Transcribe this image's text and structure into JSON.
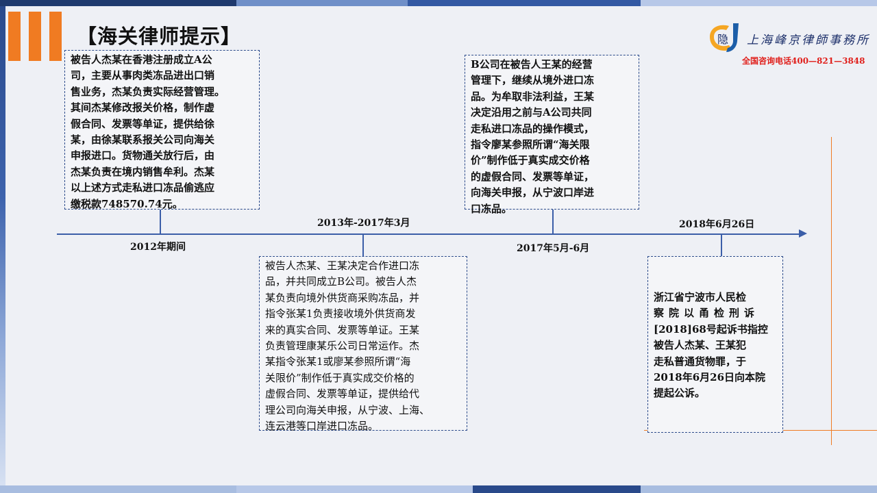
{
  "header": {
    "title": "【海关律师提示】",
    "firm_name": "上海峰京律師事務所",
    "phone": "全国咨询电话400—821—3848",
    "logo_char": "隐"
  },
  "colors": {
    "accent_orange": "#f07b22",
    "timeline_blue": "#3b5ea8",
    "phone_red": "#e0201c"
  },
  "timeline": {
    "events": [
      {
        "date": "2012年期间",
        "lines": [
          "被告人杰某在香港注册成立A公",
          "司，主要从事肉类冻品进出口销",
          "售业务，杰某负责实际经营管理。",
          "其间杰某修改报关价格，制作虚",
          "假合同、发票等单证，提供给徐",
          "某，由徐某联系报关公司向海关",
          "申报进口。货物通关放行后，由",
          "杰某负责在境内销售牟利。杰某",
          "以上述方式走私进口冻品偷逃应",
          "缴税款748570.74元。"
        ]
      },
      {
        "date": "2013年-2017年3月",
        "lines": [
          "被告人杰某、王某决定合作进口冻",
          "品，并共同成立B公司。被告人杰",
          "某负责向境外供货商采购冻品，并",
          "指令张某1负责接收境外供货商发",
          "来的真实合同、发票等单证。王某",
          "负责管理康某乐公司日常运作。杰",
          "某指令张某1或廖某参照所谓“海",
          "关限价”制作低于真实成交价格的",
          "虚假合同、发票等单证，提供给代",
          "理公司向海关申报，从宁波、上海、",
          "连云港等口岸进口冻品。"
        ]
      },
      {
        "date": "2017年5月-6月",
        "lines": [
          "B公司在被告人王某的经营",
          "管理下，继续从境外进口冻",
          "品。为牟取非法利益，王某",
          "决定沿用之前与A公司共同",
          "走私进口冻品的操作模式，",
          "指令廖某参照所谓“海关限",
          "价”制作低于真实成交价格",
          "的虚假合同、发票等单证，",
          "向海关申报，从宁波口岸进",
          "口冻品。"
        ]
      },
      {
        "date": "2018年6月26日",
        "lines": [
          "浙江省宁波市人民检",
          "察院以甬检刑诉",
          "[2018]68号起诉书指控",
          "被告人杰某、王某犯",
          "走私普通货物罪，于",
          "2018年6月26日向本院",
          "提起公诉。"
        ]
      }
    ]
  }
}
